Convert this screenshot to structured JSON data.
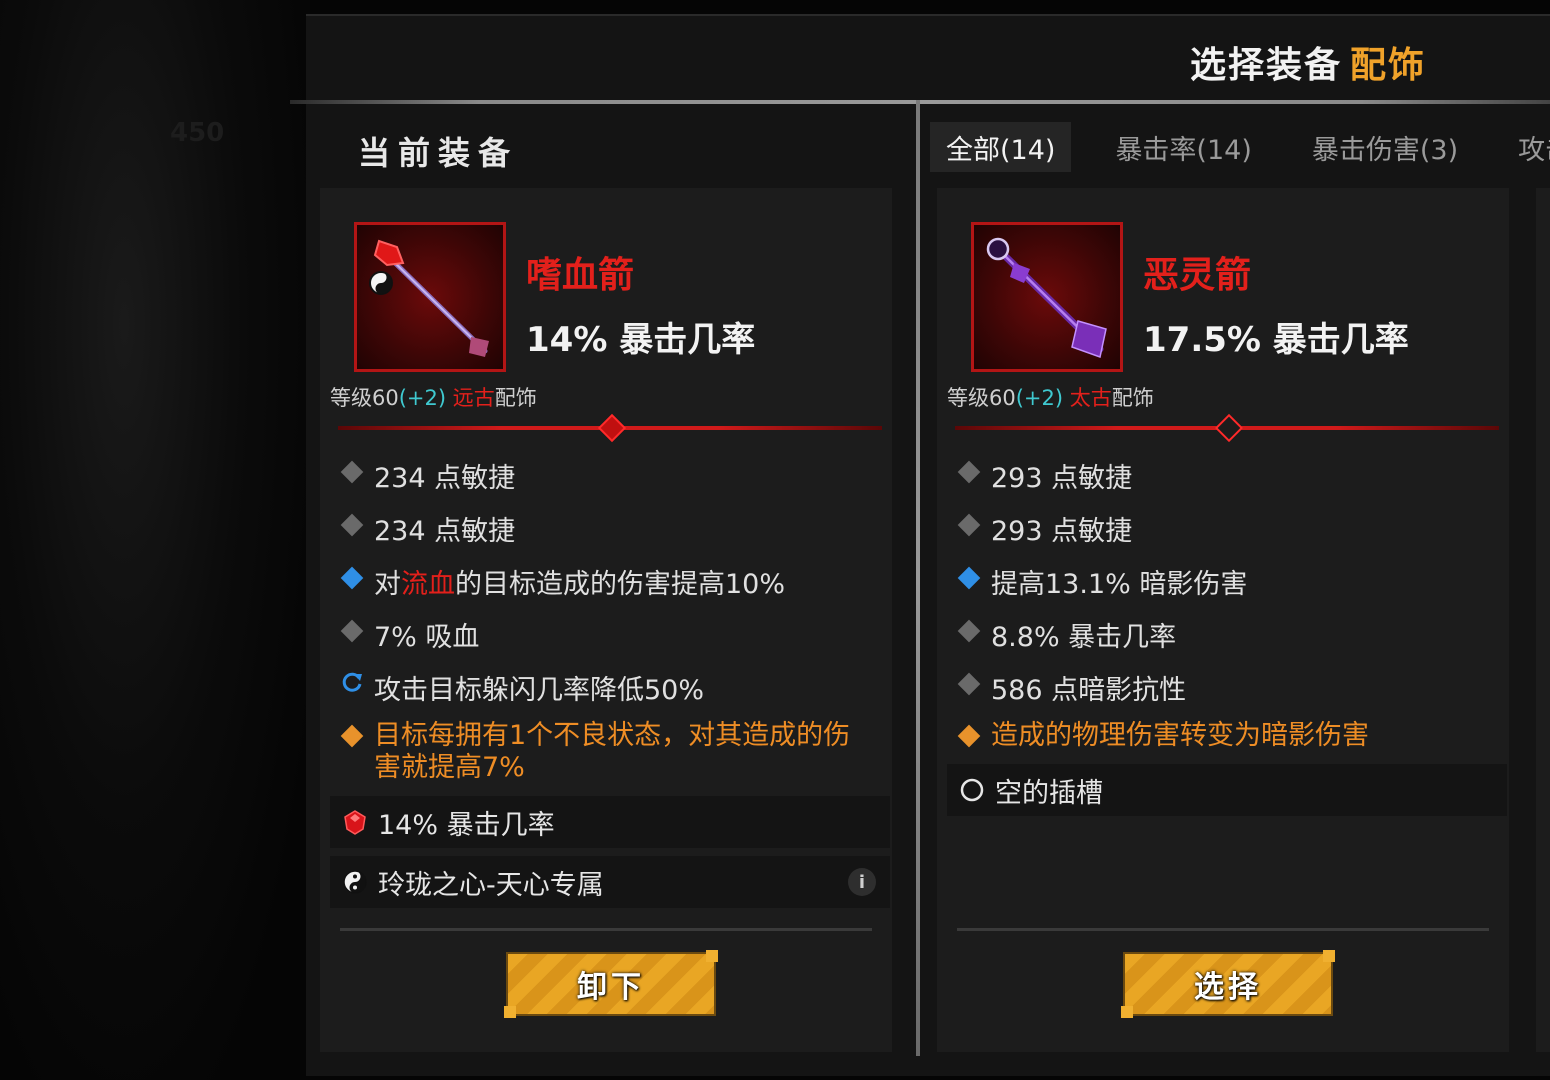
{
  "header": {
    "title": "选择装备",
    "title_category": "配饰"
  },
  "left": {
    "section_title": "当前装备",
    "card": {
      "name": "嗜血箭",
      "main_stat": "14% 暴击几率",
      "level_text": "等级60",
      "level_plus": "(+2)",
      "rarity": "远古",
      "type": "配饰",
      "attrs": [
        {
          "text": "234 点敏捷",
          "bullet": "grey"
        },
        {
          "text": "234 点敏捷",
          "bullet": "grey"
        }
      ],
      "attr3_pre": "对",
      "attr3_red": "流血",
      "attr3_post": "的目标造成的伤害提高10%",
      "attr4": "7% 吸血",
      "attr5": "攻击目标躲闪几率降低50%",
      "attr6": "目标每拥有1个不良状态，对其造成的伤害就提高7%",
      "gem_slot": "14% 暴击几率",
      "soul_slot": "玲珑之心-天心专属",
      "info_glyph": "i",
      "button": "卸下"
    }
  },
  "tabs": [
    {
      "label": "全部(14)",
      "active": true
    },
    {
      "label": "暴击率(14)",
      "active": false
    },
    {
      "label": "暴击伤害(3)",
      "active": false
    },
    {
      "label": "攻击速度",
      "active": false
    }
  ],
  "right": {
    "card": {
      "name": "恶灵箭",
      "main_stat": "17.5% 暴击几率",
      "level_text": "等级60",
      "level_plus": "(+2)",
      "rarity": "太古",
      "type": "配饰",
      "attr1": "293 点敏捷",
      "attr2": "293 点敏捷",
      "attr3": "提高13.1% 暗影伤害",
      "attr4": "8.8% 暴击几率",
      "attr5": "586 点暗影抗性",
      "attr6": "造成的物理伤害转变为暗影伤害",
      "empty_slot": "空的插槽",
      "button": "选择"
    }
  },
  "background": {
    "ghost_number": "450"
  },
  "colors": {
    "accent_orange": "#f0a22a",
    "item_red": "#e3201b",
    "level_plus": "#3fc9d0",
    "legendary_text": "#ee8d25",
    "bullet_blue": "#2f8fe6"
  }
}
